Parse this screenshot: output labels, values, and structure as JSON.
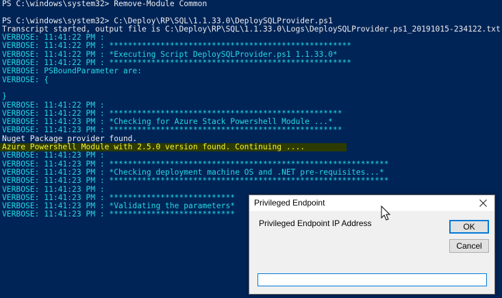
{
  "console": {
    "lines": [
      {
        "text": "PS C:\\windows\\system32> Remove-Module Common",
        "color": "white"
      },
      {
        "text": "",
        "color": "white"
      },
      {
        "text": "PS C:\\windows\\system32> C:\\Deploy\\RP\\SQL\\1.1.33.0\\DeploySQLProvider.ps1",
        "color": "white"
      },
      {
        "text": "Transcript started, output file is C:\\Deploy\\RP\\SQL\\1.1.33.0\\Logs\\DeploySQLProvider.ps1_20191015-234122.txt",
        "color": "white"
      },
      {
        "text": "VERBOSE: 11:41:22 PM :",
        "color": "cyan"
      },
      {
        "text": "VERBOSE: 11:41:22 PM : ****************************************************",
        "color": "cyan"
      },
      {
        "text": "VERBOSE: 11:41:22 PM : *Executing Script DeploySQLProvider.ps1 1.1.33.0*",
        "color": "cyan"
      },
      {
        "text": "VERBOSE: 11:41:22 PM : ****************************************************",
        "color": "cyan"
      },
      {
        "text": "VERBOSE: PSBoundParameter are:",
        "color": "cyan"
      },
      {
        "text": "VERBOSE: {",
        "color": "cyan"
      },
      {
        "text": "",
        "color": "cyan"
      },
      {
        "text": "}",
        "color": "cyan"
      },
      {
        "text": "VERBOSE: 11:41:22 PM :",
        "color": "cyan"
      },
      {
        "text": "VERBOSE: 11:41:22 PM : **************************************************",
        "color": "cyan"
      },
      {
        "text": "VERBOSE: 11:41:23 PM : *Checking for Azure Stack Powershell Module ...*",
        "color": "cyan"
      },
      {
        "text": "VERBOSE: 11:41:23 PM : **************************************************",
        "color": "cyan"
      },
      {
        "text": "Nuget Package provider found.",
        "color": "white"
      },
      {
        "text": "Azure Powershell Module with 2.5.0 version found. Continuing ....",
        "color": "highlight"
      },
      {
        "text": "VERBOSE: 11:41:23 PM :",
        "color": "cyan"
      },
      {
        "text": "VERBOSE: 11:41:23 PM : ************************************************************",
        "color": "cyan"
      },
      {
        "text": "VERBOSE: 11:41:23 PM : *Checking deployment machine OS and .NET pre-requisites...*",
        "color": "cyan"
      },
      {
        "text": "VERBOSE: 11:41:23 PM : ************************************************************",
        "color": "cyan"
      },
      {
        "text": "VERBOSE: 11:41:23 PM :",
        "color": "cyan"
      },
      {
        "text": "VERBOSE: 11:41:23 PM : ***************************",
        "color": "cyan"
      },
      {
        "text": "VERBOSE: 11:41:23 PM : *Validating the parameters*",
        "color": "cyan"
      },
      {
        "text": "VERBOSE: 11:41:23 PM : ***************************",
        "color": "cyan"
      }
    ],
    "colors": {
      "background": "#012456",
      "white": "#EEEDF0",
      "cyan": "#27D8E8",
      "highlight_bg": "#2E3B00",
      "highlight_fg": "#F5F53C"
    }
  },
  "dialog": {
    "title": "Privileged Endpoint",
    "close_icon": "close-icon",
    "prompt": "Privileged Endpoint IP Address",
    "ok_label": "OK",
    "cancel_label": "Cancel",
    "input_value": ""
  },
  "cursor": {
    "icon": "mouse-pointer-icon"
  }
}
